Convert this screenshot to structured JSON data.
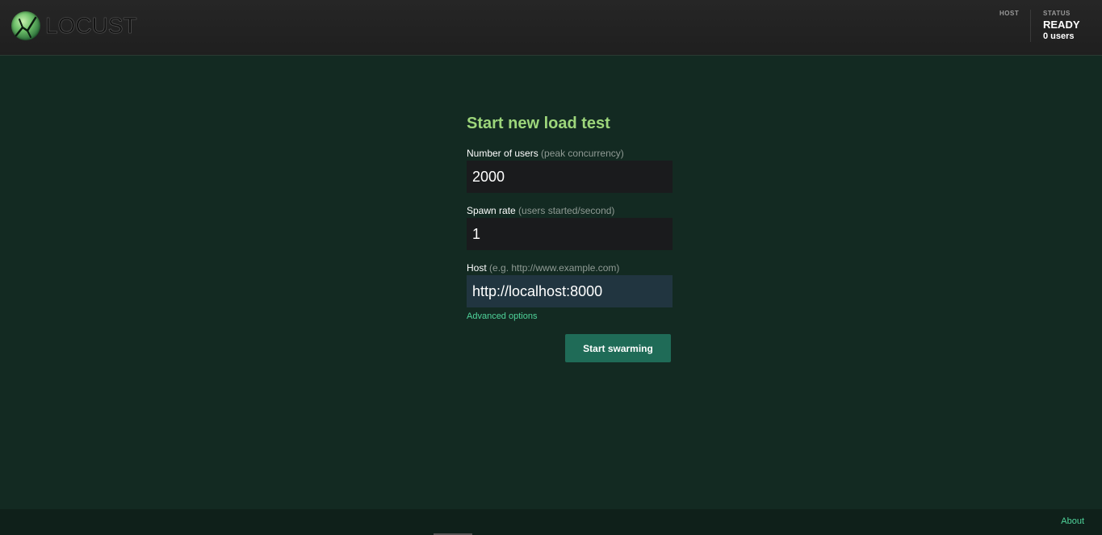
{
  "header": {
    "logo_text": "LOCUST",
    "host_label": "HOST",
    "status_label": "STATUS",
    "status_value": "READY",
    "users_count": "0 users"
  },
  "form": {
    "title": "Start new load test",
    "users_label": "Number of users",
    "users_hint": "(peak concurrency)",
    "users_value": "2000",
    "spawn_label": "Spawn rate",
    "spawn_hint": "(users started/second)",
    "spawn_value": "1",
    "host_label": "Host",
    "host_hint": "(e.g. http://www.example.com)",
    "host_value": "http://localhost:8000",
    "advanced_link": "Advanced options",
    "start_button": "Start swarming"
  },
  "footer": {
    "about_link": "About"
  },
  "colors": {
    "accent": "#9dd67b",
    "link": "#4fd39a",
    "button": "#1f6b57",
    "background": "#132a22"
  }
}
